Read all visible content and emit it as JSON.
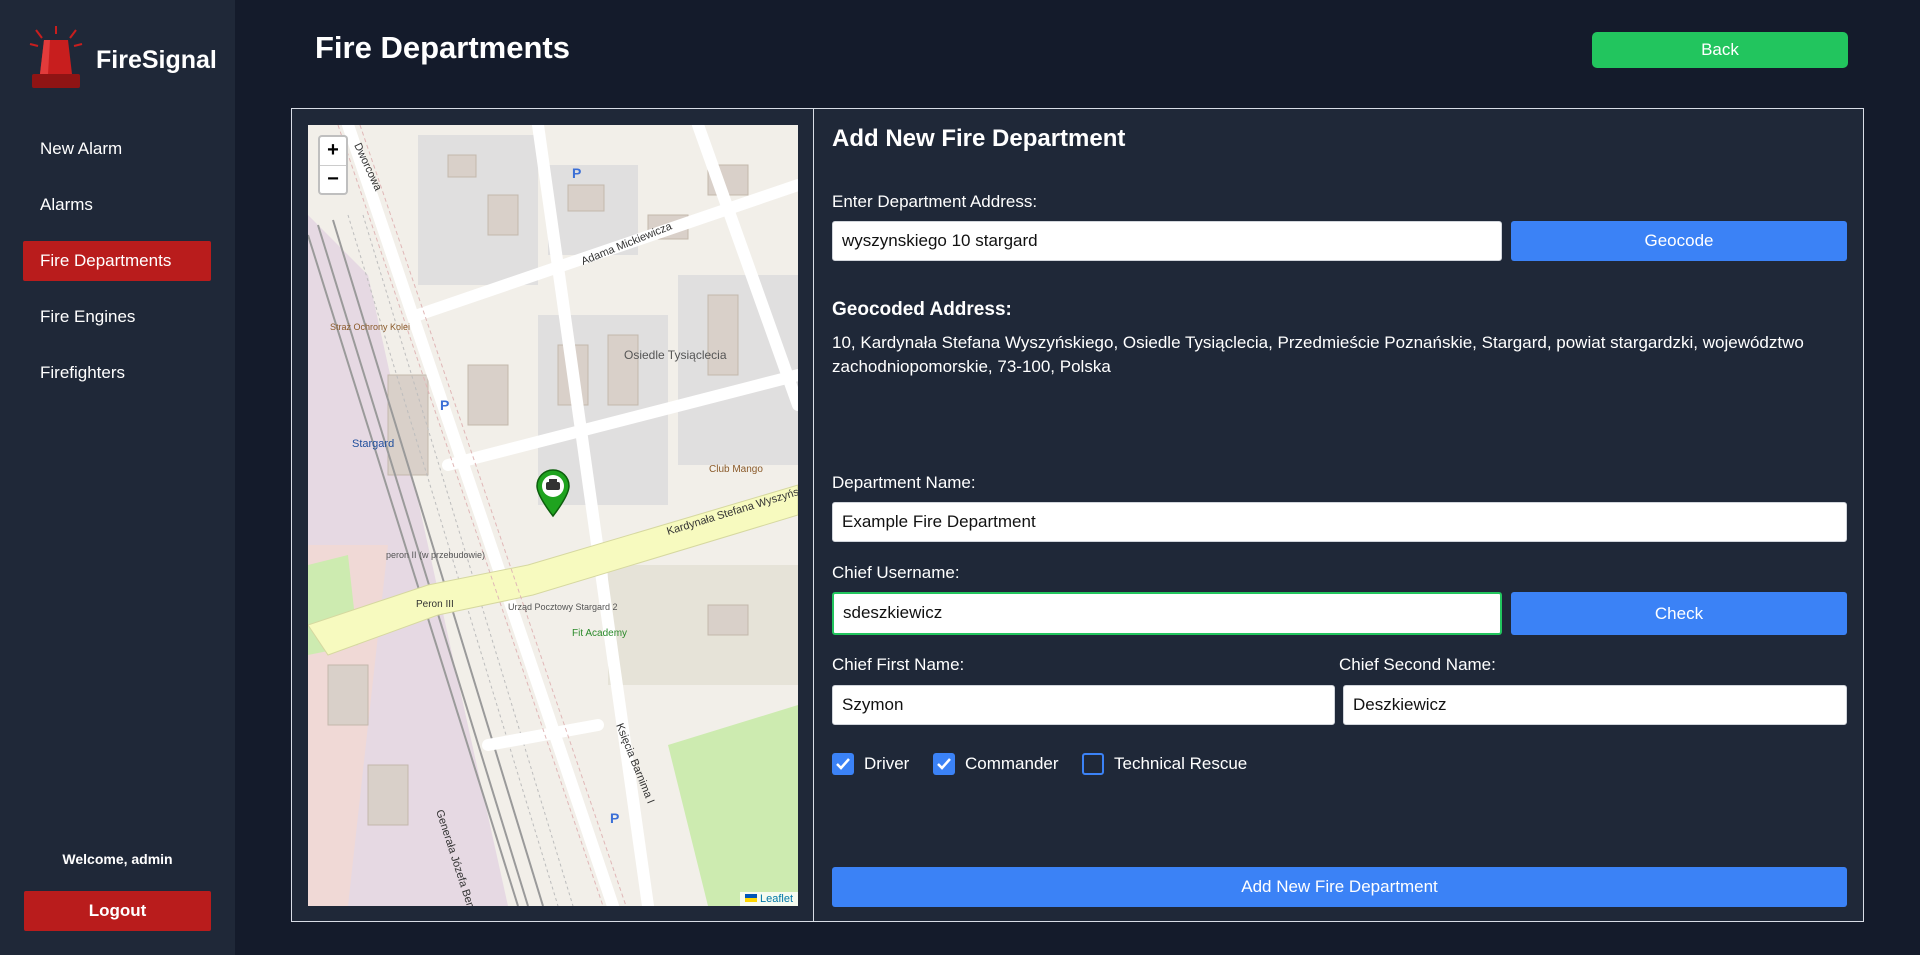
{
  "brand": {
    "name": "FireSignal",
    "logo_icon": "siren-icon"
  },
  "nav": {
    "items": [
      {
        "label": "New Alarm",
        "active": false
      },
      {
        "label": "Alarms",
        "active": false
      },
      {
        "label": "Fire Departments",
        "active": true
      },
      {
        "label": "Fire Engines",
        "active": false
      },
      {
        "label": "Firefighters",
        "active": false
      }
    ]
  },
  "user": {
    "welcome": "Welcome, admin",
    "logout_label": "Logout"
  },
  "header": {
    "title": "Fire Departments",
    "back_label": "Back"
  },
  "map": {
    "zoom_in": "+",
    "zoom_out": "−",
    "attribution": "Leaflet",
    "labels": {
      "street_1": "Dworcowa",
      "street_2": "Adama Mickiewicza",
      "street_3": "Kardynała Stefana Wyszyńskiego",
      "street_4": "Księcia Barnima I",
      "street_5": "Generała Józefa Bema",
      "area_1": "Osiedle Tysiąclecia",
      "poi_1": "Club Mango",
      "poi_2": "Stargard",
      "poi_3": "Straż Ochrony Kolei",
      "poi_4": "Urząd Pocztowy Stargard 2",
      "poi_5": "Fit Academy",
      "poi_6": "peron II (w przebudowie)",
      "poi_7": "Peron III"
    }
  },
  "form": {
    "title": "Add New Fire Department",
    "address_label": "Enter Department Address:",
    "address_value": "wyszynskiego 10 stargard",
    "geocode_label": "Geocode",
    "geocoded_title": "Geocoded Address:",
    "geocoded_value": "10, Kardynała Stefana Wyszyńskiego, Osiedle Tysiąclecia, Przedmieście Poznańskie, Stargard, powiat stargardzki, województwo zachodniopomorskie, 73-100, Polska",
    "name_label": "Department Name:",
    "name_value": "Example Fire Department",
    "chief_user_label": "Chief Username:",
    "chief_user_value": "sdeszkiewicz",
    "check_label": "Check",
    "first_name_label": "Chief First Name:",
    "first_name_value": "Szymon",
    "second_name_label": "Chief Second Name:",
    "second_name_value": "Deszkiewicz",
    "roles": [
      {
        "label": "Driver",
        "checked": true
      },
      {
        "label": "Commander",
        "checked": true
      },
      {
        "label": "Technical Rescue",
        "checked": false
      }
    ],
    "submit_label": "Add New Fire Department"
  },
  "colors": {
    "background": "#141b2b",
    "sidebar": "#1f2838",
    "accent_red": "#b91c1c",
    "accent_green": "#22c55e",
    "accent_blue": "#3b82f6"
  }
}
